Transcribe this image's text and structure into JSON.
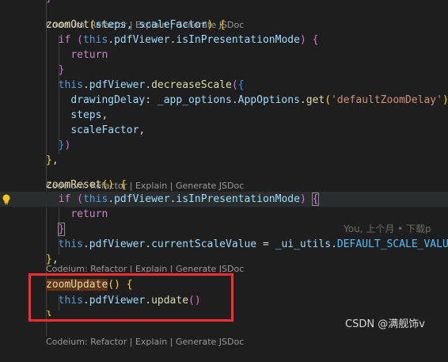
{
  "codelens": {
    "items": [
      "Codeium: Refactor",
      "Explain",
      "Generate JSDoc"
    ],
    "sep": " | "
  },
  "code": {
    "top_brace": "}",
    "zoomOut": {
      "name": "zoomOut",
      "params": "steps, scaleFactor",
      "if_kw": "if",
      "cond_this": "this",
      "cond_prop": "pdfViewer",
      "cond_prop2": "isInPresentationMode",
      "return_kw": "return",
      "call_this": "this",
      "call_prop": "pdfViewer",
      "call_fn": "decreaseScale",
      "drawingDelay_key": "drawingDelay",
      "drawingDelay_obj": "_app_options",
      "drawingDelay_cls": "AppOptions",
      "drawingDelay_get": "get",
      "drawingDelay_str": "'defaultZoomDelay'",
      "steps": "steps",
      "scaleFactor": "scaleFactor"
    },
    "zoomReset": {
      "name": "zoomReset",
      "if_kw": "if",
      "cond_this": "this",
      "cond_prop": "pdfViewer",
      "cond_prop2": "isInPresentationMode",
      "return_kw": "return",
      "assign_this": "this",
      "assign_prop": "pdfViewer",
      "assign_prop2": "currentScaleValue",
      "assign_obj": "_ui_utils",
      "assign_const": "DEFAULT_SCALE_VALUE"
    },
    "zoomUpdate": {
      "name": "zoomUpdate",
      "call_this": "this",
      "call_prop": "pdfViewer",
      "call_fn": "update"
    }
  },
  "blame": "You, 上个月 • 下载p",
  "watermark": "CSDN @满舰饰v",
  "colors": {
    "background": "#1e1e1e",
    "highlight_box": "#ff2a2a",
    "bracket_gold": "#ffd700",
    "bracket_purple": "#da70d6",
    "bracket_blue": "#179fff"
  }
}
